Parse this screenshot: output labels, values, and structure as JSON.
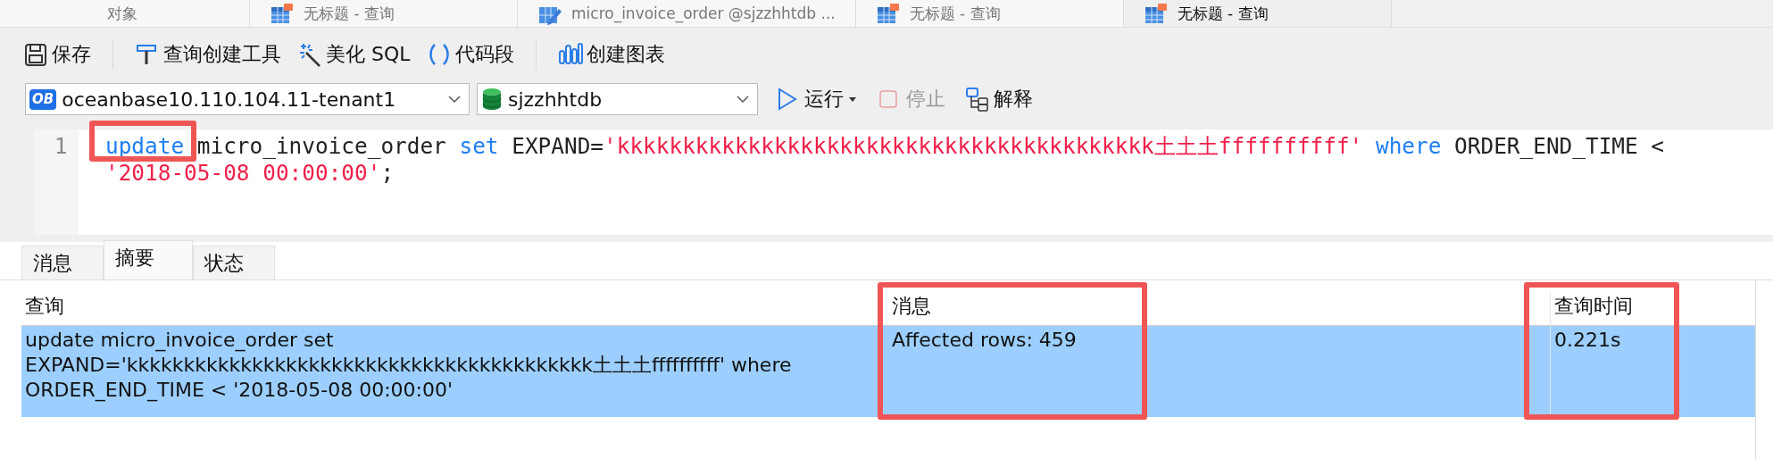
{
  "document_tabs": [
    {
      "label": "对象",
      "kind": "object",
      "selected": false
    },
    {
      "label": "无标题 - 查询",
      "kind": "query",
      "selected": false
    },
    {
      "label": "micro_invoice_order @sjzzhhtdb ...",
      "kind": "table",
      "selected": false
    },
    {
      "label": "无标题 - 查询",
      "kind": "query",
      "selected": false
    },
    {
      "label": "无标题 - 查询",
      "kind": "query",
      "selected": true
    }
  ],
  "toolbar": [
    {
      "kind": "save",
      "label": "保存"
    },
    {
      "kind": "separator"
    },
    {
      "kind": "builder",
      "label": "查询创建工具"
    },
    {
      "kind": "beautify",
      "label": "美化 SQL"
    },
    {
      "kind": "snippet",
      "label": "代码段"
    },
    {
      "kind": "separator"
    },
    {
      "kind": "chart",
      "label": "创建图表"
    }
  ],
  "connection": {
    "logo": "OB",
    "value": "oceanbase10.110.104.11-tenant1"
  },
  "database": {
    "value": "sjzzhhtdb"
  },
  "actions": [
    {
      "kind": "run",
      "label": "运行",
      "disabled": false
    },
    {
      "kind": "stop",
      "label": "停止",
      "disabled": true
    },
    {
      "kind": "explain",
      "label": "解释",
      "disabled": false
    }
  ],
  "editor": {
    "rows": [
      {
        "number": "1",
        "tokens": [
          {
            "kind": "keyword",
            "text": "update",
            "highlighted": true
          },
          {
            "kind": "plain",
            "text": " micro_invoice_order "
          },
          {
            "kind": "keyword",
            "text": "set"
          },
          {
            "kind": "plain",
            "text": " EXPAND="
          },
          {
            "kind": "string",
            "text": "'kkkkkkkkkkkkkkkkkkkkkkkkkkkkkkkkkkkkkkkkk土土土ffffffffff'"
          },
          {
            "kind": "keyword",
            "text": " where"
          },
          {
            "kind": "plain",
            "text": " ORDER_END_TIME <"
          }
        ]
      },
      {
        "tokens": [
          {
            "kind": "string",
            "text": "'2018-05-08 00:00:00'"
          },
          {
            "kind": "plain",
            "text": ";"
          }
        ]
      }
    ]
  },
  "result_tabs": [
    {
      "label": "消息",
      "selected": false
    },
    {
      "label": "摘要",
      "selected": true
    },
    {
      "label": "状态",
      "selected": false
    }
  ],
  "table": {
    "columns": [
      {
        "label": "查询",
        "highlighted": false
      },
      {
        "label": "消息",
        "highlighted": true
      },
      {
        "label": "查询时间",
        "highlighted": true
      }
    ],
    "rows": [
      {
        "selected": true,
        "cells": [
          [
            "update micro_invoice_order set",
            "EXPAND='kkkkkkkkkkkkkkkkkkkkkkkkkkkkkkkkkkkkkkkkk土土土ffffffffff' where",
            "ORDER_END_TIME < '2018-05-08 00:00:00'"
          ],
          [
            "Affected rows: 459"
          ],
          [
            "0.221s"
          ]
        ]
      }
    ]
  }
}
